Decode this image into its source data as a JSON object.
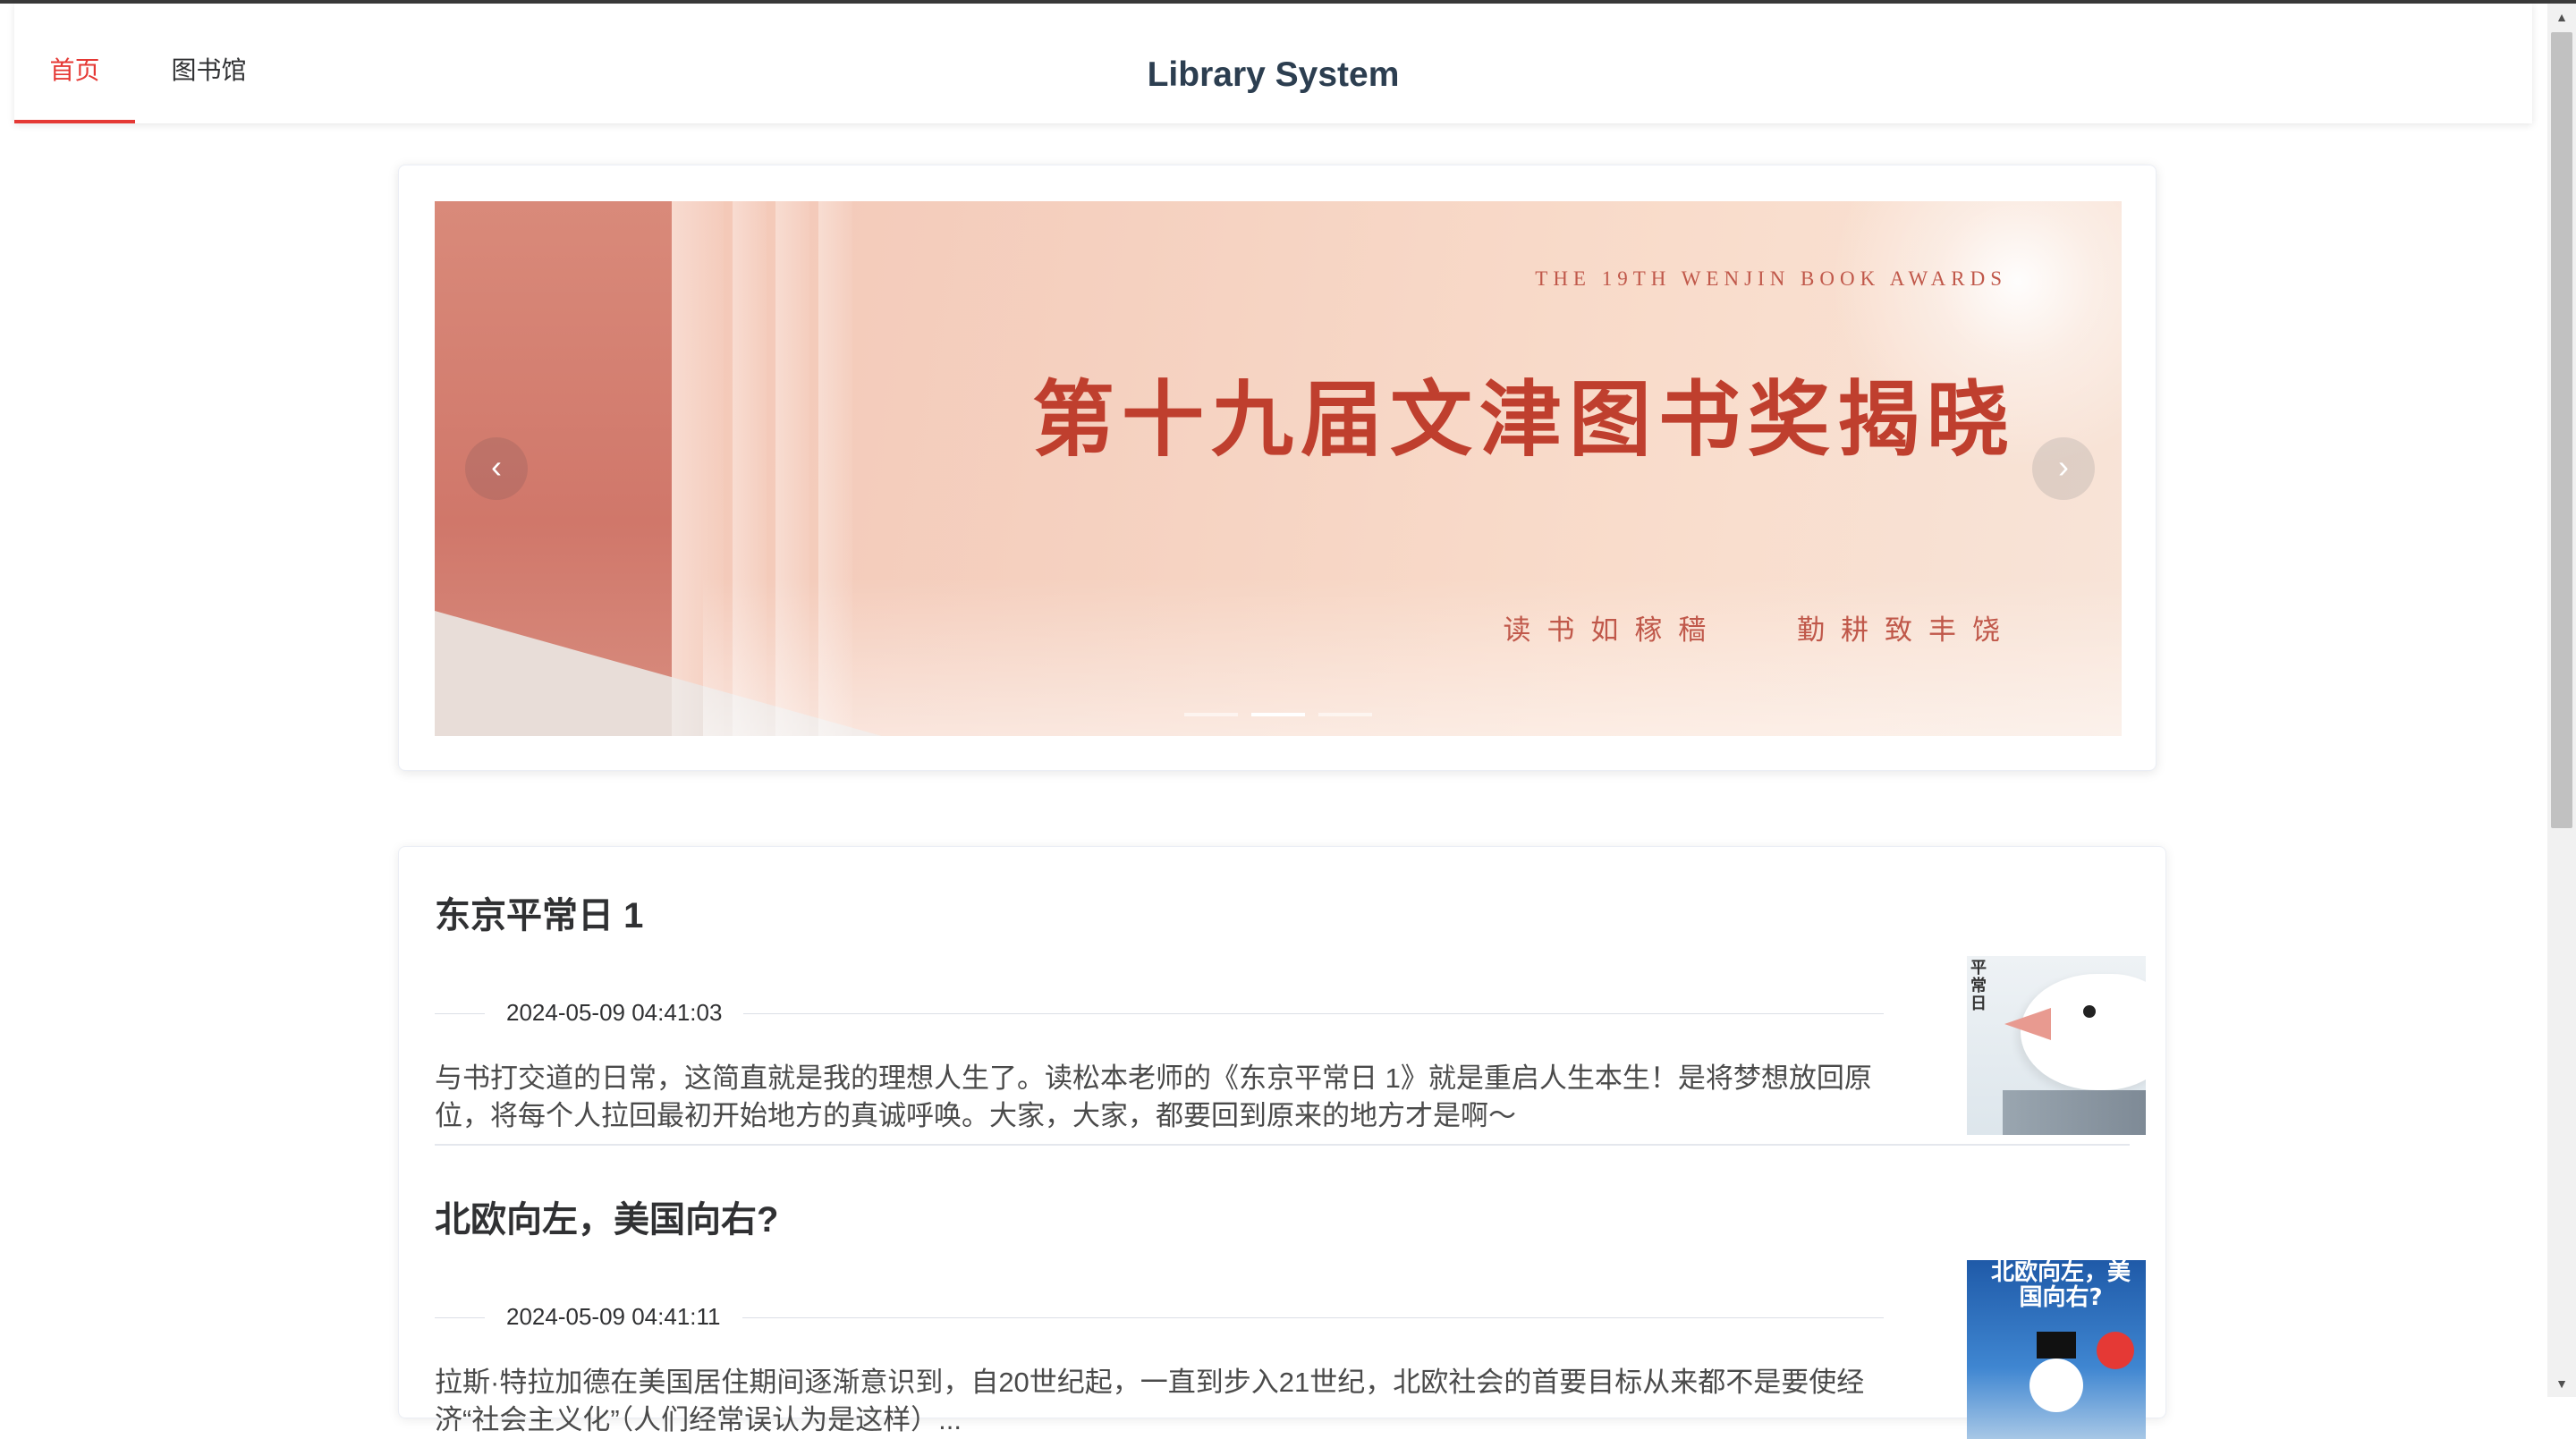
{
  "nav": {
    "items": [
      {
        "label": "首页",
        "active": true
      },
      {
        "label": "图书馆",
        "active": false
      }
    ],
    "title": "Library System",
    "accent_color": "#e53935"
  },
  "carousel": {
    "prev_icon": "chevron-left-icon",
    "next_icon": "chevron-right-icon",
    "prev_glyph": "‹",
    "next_glyph": "›",
    "slide_count": 3,
    "active_index": 1,
    "slide": {
      "heading_en": "THE 19TH WENJIN BOOK AWARDS",
      "heading_cn": "第十九届文津图书奖揭晓",
      "motto": "读书如稼穑   勤耕致丰饶"
    }
  },
  "articles": [
    {
      "title": "东京平常日 1",
      "date": "2024-05-09 04:41:03",
      "summary": "与书打交道的日常，这简直就是我的理想人生了。读松本老师的《东京平常日 1》就是重启人生本生！是将梦想放回原位，将每个人拉回最初开始地方的真诚呼唤。大家，大家，都要回到原来的地方才是啊～",
      "cover_text": "平常日"
    },
    {
      "title": "北欧向左，美国向右?",
      "date": "2024-05-09 04:41:11",
      "summary": "拉斯·特拉加德在美国居住期间逐渐意识到，自20世纪起，一直到步入21世纪，北欧社会的首要目标从来都不是要使经济“社会主义化”（人们经常误认为是这样）...",
      "cover_text": "北欧向左，美国向右?"
    }
  ],
  "scrollbar": {
    "up_glyph": "▲",
    "down_glyph": "▼"
  }
}
